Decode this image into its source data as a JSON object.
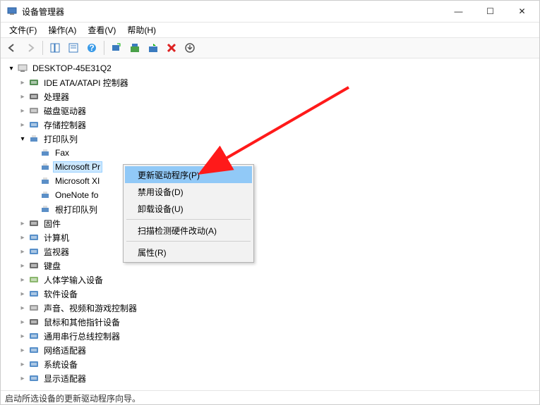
{
  "window": {
    "title": "设备管理器",
    "min": "—",
    "max": "☐",
    "close": "✕"
  },
  "menu": {
    "file": "文件(F)",
    "action": "操作(A)",
    "view": "查看(V)",
    "help": "帮助(H)"
  },
  "toolbar_icons": {
    "back": "back-icon",
    "forward": "forward-icon",
    "showhide": "showhide-icon",
    "properties": "properties-icon",
    "help": "help-icon",
    "scan": "scan-icon",
    "update": "update-icon",
    "disable": "disable-icon",
    "uninstall": "uninstall-icon",
    "newer": "newer-icon"
  },
  "root": {
    "label": "DESKTOP-45E31Q2"
  },
  "categories": [
    {
      "label": "IDE ATA/ATAPI 控制器",
      "icon": "ide"
    },
    {
      "label": "处理器",
      "icon": "cpu"
    },
    {
      "label": "磁盘驱动器",
      "icon": "disk"
    },
    {
      "label": "存储控制器",
      "icon": "storage"
    }
  ],
  "printers_category": {
    "label": "打印队列",
    "icon": "printer"
  },
  "printers": [
    {
      "label": "Fax"
    },
    {
      "label": "Microsoft Pr",
      "selected": true
    },
    {
      "label": "Microsoft XI"
    },
    {
      "label": "OneNote fo"
    },
    {
      "label": "根打印队列"
    }
  ],
  "categories2": [
    {
      "label": "固件",
      "icon": "firmware"
    },
    {
      "label": "计算机",
      "icon": "computer"
    },
    {
      "label": "监视器",
      "icon": "monitor"
    },
    {
      "label": "键盘",
      "icon": "keyboard"
    },
    {
      "label": "人体学输入设备",
      "icon": "hid"
    },
    {
      "label": "软件设备",
      "icon": "software"
    },
    {
      "label": "声音、视频和游戏控制器",
      "icon": "audio"
    },
    {
      "label": "鼠标和其他指针设备",
      "icon": "mouse"
    },
    {
      "label": "通用串行总线控制器",
      "icon": "usb"
    },
    {
      "label": "网络适配器",
      "icon": "network"
    },
    {
      "label": "系统设备",
      "icon": "system"
    },
    {
      "label": "显示适配器",
      "icon": "display"
    }
  ],
  "context_menu": {
    "update": "更新驱动程序(P)",
    "disable": "禁用设备(D)",
    "uninstall": "卸载设备(U)",
    "scan": "扫描检测硬件改动(A)",
    "properties": "属性(R)"
  },
  "status": "启动所选设备的更新驱动程序向导。"
}
